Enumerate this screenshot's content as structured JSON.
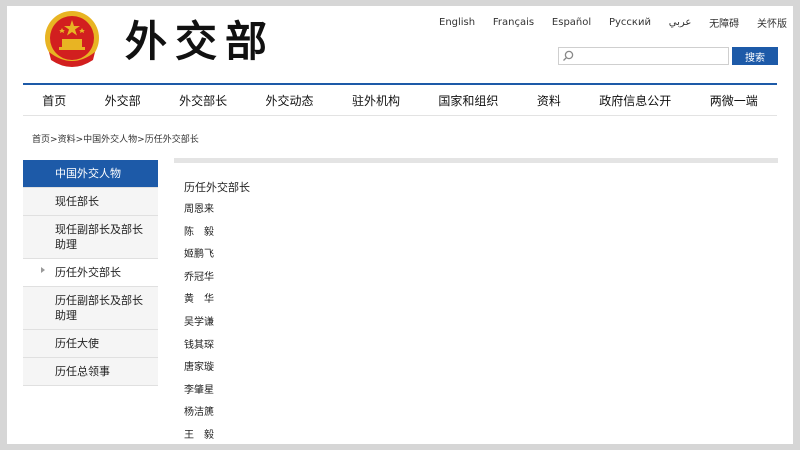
{
  "header": {
    "logo_text": "外交部",
    "languages": [
      "English",
      "Français",
      "Español",
      "Русский",
      "عربي",
      "无障碍",
      "关怀版"
    ],
    "search": {
      "value": "",
      "placeholder": "",
      "button_label": "搜索"
    }
  },
  "nav": {
    "items": [
      "首页",
      "外交部",
      "外交部长",
      "外交动态",
      "驻外机构",
      "国家和组织",
      "资料",
      "政府信息公开",
      "两微一端"
    ]
  },
  "breadcrumb": {
    "items": [
      "首页",
      "资料",
      "中国外交人物",
      "历任外交部长"
    ],
    "separator": ">"
  },
  "sidebar": {
    "title": "中国外交人物",
    "items": [
      {
        "label": "现任部长"
      },
      {
        "label": "现任副部长及部长助理"
      },
      {
        "label": "历任外交部长",
        "active": true
      },
      {
        "label": "历任副部长及部长助理"
      },
      {
        "label": "历任大使"
      },
      {
        "label": "历任总领事"
      }
    ]
  },
  "content": {
    "title": "历任外交部长",
    "names": [
      "周恩来",
      "陈　毅",
      "姬鹏飞",
      "乔冠华",
      "黄　华",
      "吴学谦",
      "钱其琛",
      "唐家璇",
      "李肇星",
      "杨洁篪",
      "王　毅"
    ]
  },
  "colors": {
    "accent": "#1d5aa8",
    "emblem_red": "#d21f1f",
    "emblem_gold": "#e8b423"
  }
}
